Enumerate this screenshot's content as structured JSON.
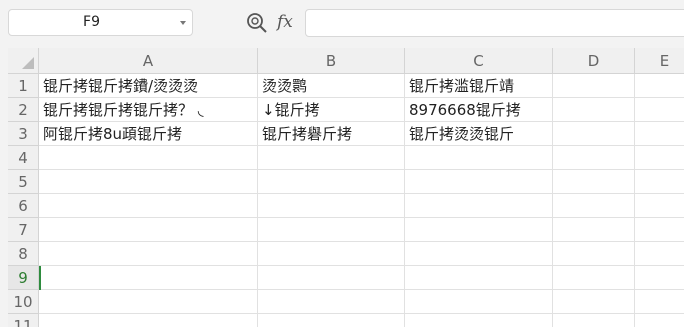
{
  "name_box": {
    "value": "F9"
  },
  "formula_bar": {
    "fx_label": "fx",
    "value": ""
  },
  "columns": [
    "A",
    "B",
    "C",
    "D",
    "E"
  ],
  "rows": [
    "1",
    "2",
    "3",
    "4",
    "5",
    "6",
    "7",
    "8",
    "9",
    "10",
    "11"
  ],
  "active_row": "9",
  "selected_cell": "F9",
  "cells": {
    "A1": "锟斤拷锟斤拷鐨/烫烫烫",
    "B1": "烫烫鹮",
    "C1": "锟斤拷滥锟斤靖",
    "A2": "锟斤拷锟斤拷锟斤拷？ ◟",
    "B2": "↓锟斤拷",
    "C2": "8976668锟斤拷",
    "A3": "阿锟斤拷8u頙锟斤拷",
    "B3": "锟斤拷礜斤拷",
    "C3": "锟斤拷烫烫锟斤"
  },
  "icons": {
    "zoom": "zoom-magnifier-icon",
    "fx": "function-icon",
    "dropdown": "chevron-down-icon"
  },
  "colors": {
    "selection": "#2e8b3e",
    "gridline": "#e1e1e1",
    "header_bg": "#f0f0f0"
  }
}
